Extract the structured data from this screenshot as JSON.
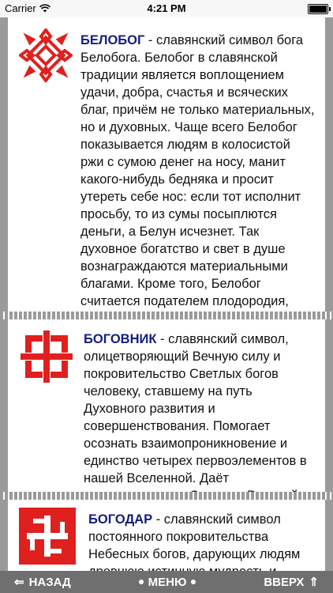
{
  "status": {
    "carrier": "Carrier",
    "time": "4:21 PM"
  },
  "blocks": [
    {
      "title": "БЕЛОБОГ",
      "text": " - славянский символ бога Белобога. Белобог в славянской традиции является воплощением удачи, добра, счастья и всяческих благ, причём не только материальных, но и духовных. Чаще всего Белобог показывается людям в колосистой ржи с сумою денег на носу, манит какого-нибудь бедняка и просит утереть себе нос: если тот исполнит просьбу, то из сумы посыплются деньги, а Белун исчезнет. Так духовное богатство и свет в душе вознаграждаются материальными благами. Кроме того, Белобог считается подателем плодородия, помогает жнецам с посевами, сборами урожая. Этот Бог по своей сути является дневным и весенним небом."
    },
    {
      "title": "БОГОВНИК",
      "text": " - славянский символ, олицетворяющий Вечную силу и покровительство Светлых богов человеку, ставшему на путь Духовного развития и совершенствования. Помогает осознать взаимопроникновение и единство четырех первоэлементов в нашей Вселенной. Даёт покровительство Старших Родичей его обладателю."
    },
    {
      "title": "БОГОДАР",
      "text": " - славянский символ постоянного покровительства Небесных богов, дарующих людям древнюю истинную мудрость и"
    }
  ],
  "nav": {
    "back": "НАЗАД",
    "menu": "МЕНЮ",
    "up": "ВВЕРХ"
  },
  "colors": {
    "symbol_red": "#e0201e",
    "title_blue": "#14207a",
    "bar_gray": "#6f6f6f"
  }
}
